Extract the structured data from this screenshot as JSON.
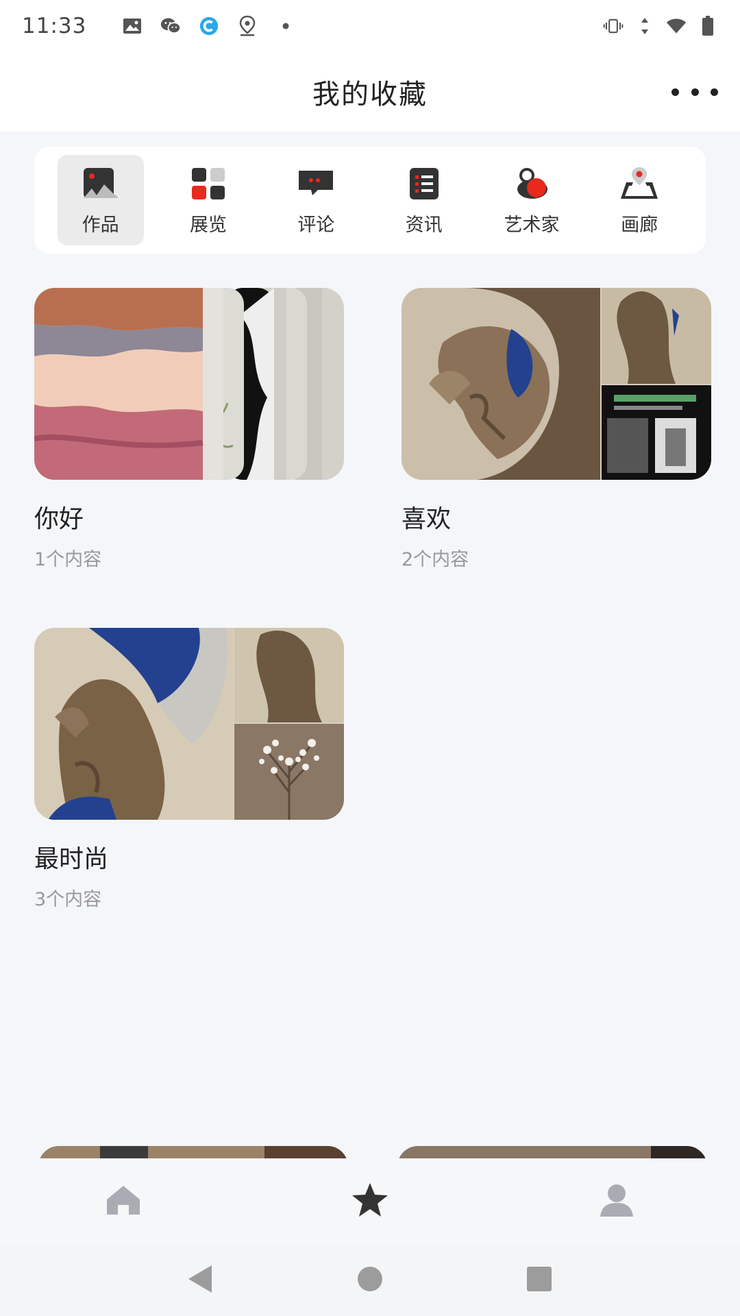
{
  "status_bar": {
    "time": "11:33",
    "left_icons": [
      "image-icon",
      "wechat-icon",
      "app-c-icon",
      "location-icon",
      "dot-icon"
    ],
    "right_icons": [
      "vibrate-icon",
      "data-arrows-icon",
      "wifi-icon",
      "battery-icon"
    ]
  },
  "header": {
    "title": "我的收藏",
    "more_icon": "more-dots-icon"
  },
  "categories": [
    {
      "label": "作品",
      "icon": "artwork-icon",
      "active": true
    },
    {
      "label": "展览",
      "icon": "exhibition-icon",
      "active": false
    },
    {
      "label": "评论",
      "icon": "comment-icon",
      "active": false
    },
    {
      "label": "资讯",
      "icon": "news-icon",
      "active": false
    },
    {
      "label": "艺术家",
      "icon": "artist-icon",
      "active": false
    },
    {
      "label": "画廊",
      "icon": "gallery-icon",
      "active": false
    }
  ],
  "collections": [
    {
      "title": "你好",
      "count": "1个内容"
    },
    {
      "title": "喜欢",
      "count": "2个内容"
    },
    {
      "title": "最时尚",
      "count": "3个内容"
    }
  ],
  "tab_bar": {
    "tabs": [
      "home-icon",
      "star-icon",
      "profile-icon"
    ],
    "active": "star-icon"
  },
  "nav_bar": [
    "back-icon",
    "home-circle-icon",
    "recents-icon"
  ],
  "colors": {
    "accent_red": "#e8291c",
    "text_dark": "#222222",
    "text_muted": "#999999",
    "background": "#f4f6f9"
  }
}
